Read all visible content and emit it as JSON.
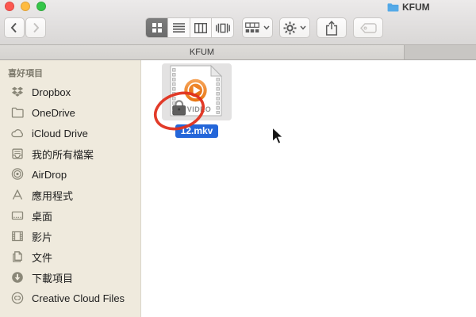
{
  "window": {
    "title": "KFUM",
    "proxy_icon": "folder-icon"
  },
  "traffic_lights": [
    "close",
    "minimize",
    "zoom"
  ],
  "toolbar": {
    "buttons": [
      {
        "name": "back",
        "icon": "chevron-left-icon",
        "enabled": true
      },
      {
        "name": "forward",
        "icon": "chevron-right-icon",
        "enabled": false
      },
      {
        "name": "icon-view",
        "icon": "grid-view-icon",
        "selected": true
      },
      {
        "name": "list-view",
        "icon": "list-view-icon",
        "selected": false
      },
      {
        "name": "column-view",
        "icon": "column-view-icon",
        "selected": false
      },
      {
        "name": "coverflow-view",
        "icon": "coverflow-view-icon",
        "selected": false
      },
      {
        "name": "arrange",
        "icon": "arrange-icon",
        "has_chevron": true
      },
      {
        "name": "action",
        "icon": "gear-icon",
        "has_chevron": true
      },
      {
        "name": "share",
        "icon": "share-icon"
      },
      {
        "name": "tag",
        "icon": "tag-icon",
        "enabled": false
      }
    ]
  },
  "tab_bar": {
    "active_tab_title": "KFUM"
  },
  "sidebar": {
    "section_header": "喜好項目",
    "items": [
      {
        "label": "Dropbox",
        "icon": "dropbox-icon"
      },
      {
        "label": "OneDrive",
        "icon": "folder-outline-icon"
      },
      {
        "label": "iCloud Drive",
        "icon": "cloud-icon"
      },
      {
        "label": "我的所有檔案",
        "icon": "all-my-files-icon"
      },
      {
        "label": "AirDrop",
        "icon": "airdrop-icon"
      },
      {
        "label": "應用程式",
        "icon": "applications-icon"
      },
      {
        "label": "桌面",
        "icon": "desktop-icon"
      },
      {
        "label": "影片",
        "icon": "movies-icon"
      },
      {
        "label": "文件",
        "icon": "documents-icon"
      },
      {
        "label": "下載項目",
        "icon": "downloads-icon"
      },
      {
        "label": "Creative Cloud Files",
        "icon": "creative-cloud-icon"
      }
    ]
  },
  "content": {
    "file": {
      "name": "12.mkv",
      "type_badge": "VIDEO",
      "selected": true,
      "icon": "video-file-icon",
      "lock_badge": "lock-icon"
    }
  },
  "annotation": {
    "type": "hand-drawn-ellipse",
    "color": "#e0301e",
    "target": "lock-badge"
  },
  "cursor": {
    "type": "arrow-pointer"
  },
  "colors": {
    "selection_blue": "#2466d9",
    "annotation_red": "#e0301e",
    "sidebar_bg": "#efeadd",
    "folder_blue": "#55aae8",
    "play_orange": "#e8740f"
  }
}
